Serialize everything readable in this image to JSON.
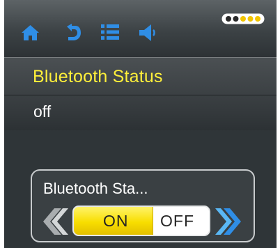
{
  "toolbar": {
    "icons": [
      "home-icon",
      "back-icon",
      "menu-list-icon",
      "speaker-icon"
    ],
    "battery": {
      "dots_total": 5,
      "dots_filled": 3
    }
  },
  "status": {
    "title": "Bluetooth Status",
    "value": "off"
  },
  "toggle": {
    "label": "Bluetooth Sta...",
    "on_label": "ON",
    "off_label": "OFF",
    "selected": "ON"
  },
  "colors": {
    "accent_blue": "#2f8ee6",
    "title_yellow": "#fff03a",
    "switch_yellow": "#f8de00"
  }
}
